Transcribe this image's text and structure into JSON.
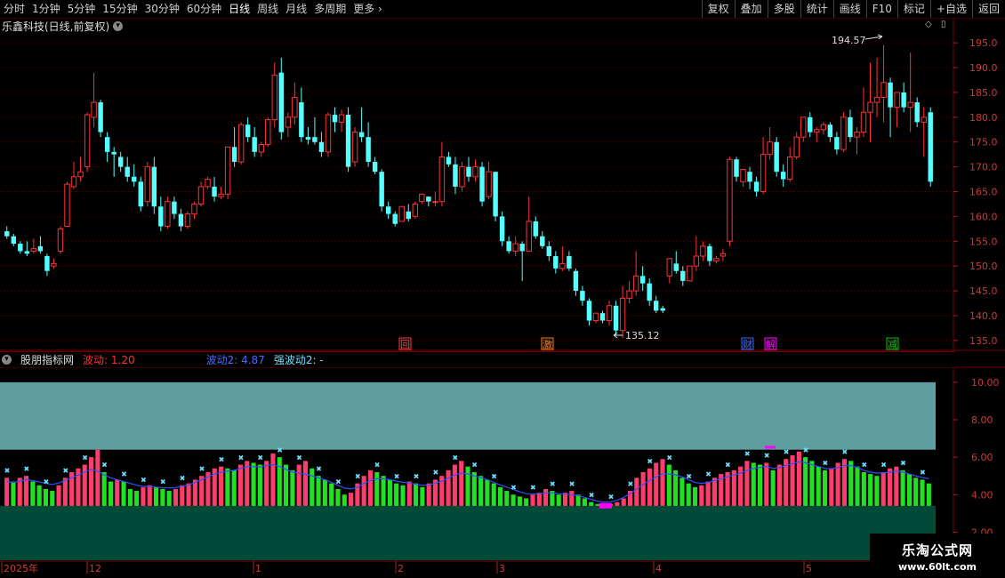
{
  "toolbar": {
    "periods": [
      "分时",
      "1分钟",
      "5分钟",
      "15分钟",
      "30分钟",
      "60分钟",
      "日线",
      "周线",
      "月线",
      "多周期",
      "更多"
    ],
    "active_period": "日线",
    "right_buttons": [
      "复权",
      "叠加",
      "多股",
      "统计",
      "画线",
      "F10",
      "标记",
      "+自选",
      "返回"
    ]
  },
  "header": {
    "title": "乐鑫科技(日线,前复权)"
  },
  "indicator": {
    "name": "股朋指标网",
    "items": [
      {
        "label": "波动: 1.20",
        "color": "#ff3030"
      },
      {
        "label": "波动2: 4.87",
        "color": "#4c6cff"
      },
      {
        "label": "强波动2: -",
        "color": "#6ee0ff"
      }
    ]
  },
  "watermark": {
    "line1": "乐淘公式网",
    "line2": "www.60lt.com"
  },
  "markers": [
    {
      "text": "回",
      "bg": "#ff3030"
    },
    {
      "text": "激",
      "bg": "#ff7800"
    },
    {
      "text": "财",
      "bg": "#3060ff"
    },
    {
      "text": "解",
      "bg": "#ff00ff"
    },
    {
      "text": "减",
      "bg": "#00c000"
    }
  ],
  "annotations": {
    "high": "194.57",
    "low": "135.12"
  },
  "time_axis": [
    "2025年",
    "12",
    "1",
    "2",
    "3",
    "4",
    "5"
  ],
  "chart_data": [
    {
      "type": "candlestick",
      "title": "乐鑫科技(日线,前复权)",
      "ylim": [
        133,
        197
      ],
      "yticks": [
        135,
        140,
        145,
        150,
        155,
        160,
        165,
        170,
        175,
        180,
        185,
        190,
        195
      ],
      "up_color": "#ff3232",
      "down_color": "#54ffff",
      "candles": [
        [
          157,
          158,
          156,
          155.5
        ],
        [
          156,
          156.5,
          154.5,
          154
        ],
        [
          154.5,
          155,
          153,
          152.5
        ],
        [
          153,
          155,
          152.5,
          152
        ],
        [
          153,
          155.5,
          153.5,
          152.5
        ],
        [
          154,
          156,
          153,
          152.5
        ],
        [
          152,
          152.5,
          149,
          148
        ],
        [
          150,
          151.5,
          150.5,
          149.5
        ],
        [
          153,
          158,
          157.5,
          152.5
        ],
        [
          158,
          167,
          166.5,
          158
        ],
        [
          166,
          171,
          168,
          165.5
        ],
        [
          168,
          172,
          169,
          167
        ],
        [
          170,
          181,
          180.5,
          169
        ],
        [
          180,
          189,
          183,
          178
        ],
        [
          183,
          183.5,
          177,
          176
        ],
        [
          176,
          177,
          173,
          171
        ],
        [
          173,
          174,
          172.5,
          168
        ],
        [
          172,
          173,
          170,
          169
        ],
        [
          170,
          172,
          168,
          167
        ],
        [
          168,
          170.5,
          167,
          166
        ],
        [
          167,
          168,
          162,
          161
        ],
        [
          163,
          171,
          170,
          162
        ],
        [
          170,
          172,
          162,
          160.5
        ],
        [
          162,
          164,
          158,
          157
        ],
        [
          158,
          164,
          163,
          157.5
        ],
        [
          163,
          164,
          160.5,
          159.5
        ],
        [
          160.5,
          161.5,
          158,
          157
        ],
        [
          158,
          161,
          160.5,
          157.5
        ],
        [
          160.5,
          163,
          162.5,
          159.5
        ],
        [
          162.5,
          167,
          166,
          162
        ],
        [
          166,
          168,
          167.5,
          165.5
        ],
        [
          166,
          168,
          164,
          163
        ],
        [
          164,
          166,
          164.5,
          163.5
        ],
        [
          164.5,
          174,
          174,
          163.5
        ],
        [
          174,
          178,
          171,
          170
        ],
        [
          171,
          179,
          178.5,
          170.5
        ],
        [
          178.5,
          180,
          176,
          175
        ],
        [
          176,
          178,
          173,
          172
        ],
        [
          173,
          175,
          174.5,
          172
        ],
        [
          174.5,
          180,
          179.5,
          174
        ],
        [
          179.5,
          191,
          188.5,
          178
        ],
        [
          189,
          192,
          177,
          175.5
        ],
        [
          178,
          181,
          180,
          176
        ],
        [
          180,
          187,
          184,
          178.5
        ],
        [
          183,
          186,
          176,
          175
        ],
        [
          176,
          178,
          175.5,
          174.5
        ],
        [
          176,
          180,
          175,
          174.5
        ],
        [
          175,
          177,
          173,
          172
        ],
        [
          173,
          181,
          180.5,
          172
        ],
        [
          180.5,
          182,
          179,
          177
        ],
        [
          179,
          181.5,
          180.5,
          177
        ],
        [
          180.5,
          182,
          170,
          169
        ],
        [
          171,
          178,
          177,
          170
        ],
        [
          177,
          182,
          176,
          175
        ],
        [
          176,
          179,
          171,
          170
        ],
        [
          171,
          172,
          169,
          168.5
        ],
        [
          169,
          169.5,
          162,
          161
        ],
        [
          162,
          163,
          160.5,
          159.5
        ],
        [
          160.5,
          161,
          158.5,
          158
        ],
        [
          159,
          161.5,
          162,
          159
        ],
        [
          161,
          162.5,
          159.5,
          159
        ],
        [
          160,
          163,
          162.5,
          159.5
        ],
        [
          163,
          164,
          164.5,
          162.5
        ],
        [
          164,
          164,
          163,
          162
        ],
        [
          163,
          165,
          163,
          162
        ],
        [
          163,
          175,
          172,
          162
        ],
        [
          172,
          173,
          170.5,
          170
        ],
        [
          170.5,
          172,
          166,
          164.5
        ],
        [
          166,
          171,
          170,
          165
        ],
        [
          170,
          172,
          168,
          167
        ],
        [
          168,
          171.5,
          170,
          167
        ],
        [
          170,
          171,
          163,
          162
        ],
        [
          164,
          171,
          169,
          163.5
        ],
        [
          169,
          169,
          160,
          159
        ],
        [
          160,
          161,
          155,
          154
        ],
        [
          155,
          156,
          153,
          152.5
        ],
        [
          153,
          156,
          154.5,
          152
        ],
        [
          154.5,
          155,
          153,
          147
        ],
        [
          153,
          164,
          159,
          156.5
        ],
        [
          159,
          160,
          156,
          155.5
        ],
        [
          156,
          157,
          154,
          153.5
        ],
        [
          154,
          155,
          152,
          151
        ],
        [
          152,
          153,
          149.5,
          148.5
        ],
        [
          149.5,
          154,
          150.5,
          149
        ],
        [
          152,
          153,
          149.5,
          149
        ],
        [
          149,
          149.5,
          145,
          144
        ],
        [
          145,
          146,
          143,
          142
        ],
        [
          143,
          143.5,
          139,
          138
        ],
        [
          139,
          140,
          140.5,
          138.5
        ],
        [
          140.5,
          141,
          139,
          138.5
        ],
        [
          139,
          143,
          142,
          138
        ],
        [
          142,
          143,
          137,
          136
        ],
        [
          137,
          146,
          143.5,
          135.5
        ],
        [
          143.5,
          147,
          145,
          142.5
        ],
        [
          145,
          153,
          148,
          144
        ],
        [
          148,
          150,
          146.5,
          145
        ],
        [
          146.5,
          147.5,
          143,
          142
        ],
        [
          143,
          144,
          141,
          140.5
        ],
        [
          141.5,
          142,
          141,
          140.5
        ],
        [
          148,
          151,
          151.5,
          146.5
        ],
        [
          150.5,
          153,
          149,
          148.5
        ],
        [
          149,
          150,
          147,
          146
        ],
        [
          147,
          148.5,
          150,
          147
        ],
        [
          150,
          156,
          152,
          149
        ],
        [
          152,
          155,
          154,
          151
        ],
        [
          154,
          154.5,
          151,
          150
        ],
        [
          151,
          152,
          151.5,
          150.5
        ],
        [
          152,
          153.5,
          152.5,
          151
        ],
        [
          155,
          172,
          171.5,
          154
        ],
        [
          171.5,
          172,
          168,
          167
        ],
        [
          167,
          169,
          169.5,
          166
        ],
        [
          169,
          170,
          167,
          165.5
        ],
        [
          167,
          168,
          165,
          164
        ],
        [
          165,
          176,
          172.5,
          164.5
        ],
        [
          172.5,
          178,
          175,
          171.5
        ],
        [
          175,
          176,
          169,
          168
        ],
        [
          169,
          170.5,
          167.5,
          166
        ],
        [
          167.5,
          174,
          172,
          167
        ],
        [
          172,
          177,
          176,
          171.5
        ],
        [
          176,
          180,
          180,
          175
        ],
        [
          180,
          181,
          177,
          176
        ],
        [
          177,
          178,
          177.5,
          175
        ],
        [
          177.5,
          179,
          178.5,
          176.5
        ],
        [
          178.5,
          179,
          176,
          175
        ],
        [
          176,
          177,
          173.5,
          172.5
        ],
        [
          173.5,
          181,
          180,
          173
        ],
        [
          180,
          181.5,
          176,
          175
        ],
        [
          176,
          178,
          177,
          172.5
        ],
        [
          177,
          186,
          181,
          176
        ],
        [
          181,
          191,
          183,
          175
        ],
        [
          183,
          192,
          184,
          180
        ],
        [
          184,
          194.57,
          187,
          179
        ],
        [
          187,
          188,
          182,
          176
        ],
        [
          182,
          185,
          185,
          178
        ],
        [
          185,
          187,
          182,
          181
        ],
        [
          182,
          193,
          183,
          177
        ],
        [
          183,
          184,
          179,
          178
        ],
        [
          179,
          182,
          180,
          172
        ],
        [
          181,
          182,
          167,
          166
        ]
      ]
    },
    {
      "type": "bar",
      "title": "股朋指标网",
      "ylim": [
        0.5,
        10.8
      ],
      "yticks": [
        2,
        4,
        6,
        8,
        10
      ],
      "series": [
        {
          "name": "波动",
          "values": [
            4.9,
            4.7,
            4.9,
            5.0,
            4.7,
            4.5,
            4.3,
            4.2,
            4.5,
            4.9,
            5.2,
            5.4,
            5.6,
            6.0,
            6.4,
            5.2,
            4.7,
            4.8,
            4.7,
            4.3,
            4.2,
            4.4,
            4.5,
            4.4,
            4.3,
            4.2,
            4.3,
            4.5,
            4.6,
            4.8,
            5.0,
            5.2,
            5.4,
            5.5,
            5.4,
            5.3,
            5.6,
            5.8,
            5.7,
            5.6,
            5.8,
            6.2,
            6.0,
            5.6,
            5.3,
            5.6,
            5.8,
            5.4,
            5.0,
            4.8,
            4.6,
            4.3,
            4.0,
            4.1,
            4.6,
            5.0,
            5.3,
            5.2,
            5.0,
            4.8,
            4.6,
            4.5,
            4.7,
            4.6,
            4.4,
            4.6,
            4.8,
            5.0,
            5.3,
            5.6,
            5.8,
            5.5,
            5.2,
            5.0,
            4.8,
            4.6,
            4.4,
            4.2,
            4.0,
            3.9,
            3.8,
            4.0,
            4.1,
            4.3,
            4.2,
            4.0,
            4.1,
            4.2,
            4.0,
            3.8,
            3.6,
            3.5,
            3.4,
            3.5,
            3.6,
            3.8,
            4.2,
            4.9,
            5.2,
            5.4,
            5.7,
            5.9,
            5.6,
            5.3,
            4.9,
            4.6,
            4.4,
            4.5,
            4.7,
            4.9,
            5.1,
            5.2,
            5.3,
            5.5,
            5.8,
            5.7,
            5.6,
            5.7,
            5.3,
            5.6,
            5.9,
            6.1,
            6.3,
            6.0,
            5.8,
            5.5,
            5.3,
            5.4,
            5.7,
            5.9,
            5.8,
            5.5,
            5.2,
            5.1,
            5.0,
            5.2,
            5.4,
            5.5,
            5.3,
            5.1,
            4.9,
            4.8,
            4.6
          ]
        },
        {
          "name": "波动2",
          "values": [
            4.7,
            4.65,
            4.72,
            4.8,
            4.75,
            4.68,
            4.6,
            4.55,
            4.62,
            4.75,
            4.9,
            5.05,
            5.2,
            5.35,
            5.25,
            5.05,
            4.9,
            4.8,
            4.7,
            4.6,
            4.5,
            4.45,
            4.42,
            4.4,
            4.38,
            4.36,
            4.38,
            4.45,
            4.52,
            4.65,
            4.8,
            4.95,
            5.1,
            5.2,
            5.25,
            5.3,
            5.4,
            5.5,
            5.5,
            5.48,
            5.55,
            5.6,
            5.5,
            5.35,
            5.2,
            5.15,
            5.1,
            5.0,
            4.9,
            4.8,
            4.65,
            4.5,
            4.35,
            4.3,
            4.4,
            4.6,
            4.75,
            4.85,
            4.85,
            4.8,
            4.72,
            4.66,
            4.62,
            4.55,
            4.5,
            4.52,
            4.6,
            4.72,
            4.88,
            5.05,
            5.15,
            5.1,
            5.0,
            4.92,
            4.8,
            4.65,
            4.52,
            4.4,
            4.28,
            4.15,
            4.05,
            4.02,
            4.05,
            4.1,
            4.1,
            4.05,
            4.02,
            4.0,
            3.95,
            3.85,
            3.75,
            3.65,
            3.6,
            3.62,
            3.7,
            3.85,
            4.05,
            4.3,
            4.55,
            4.75,
            4.95,
            5.1,
            5.1,
            5.05,
            4.95,
            4.8,
            4.65,
            4.6,
            4.65,
            4.75,
            4.85,
            4.95,
            5.05,
            5.15,
            5.3,
            5.4,
            5.45,
            5.5,
            5.4,
            5.45,
            5.55,
            5.65,
            5.75,
            5.7,
            5.6,
            5.5,
            5.4,
            5.38,
            5.45,
            5.55,
            5.55,
            5.45,
            5.3,
            5.2,
            5.15,
            5.15,
            5.2,
            5.25,
            5.2,
            5.1,
            5.0,
            4.92,
            4.85
          ]
        }
      ]
    }
  ]
}
